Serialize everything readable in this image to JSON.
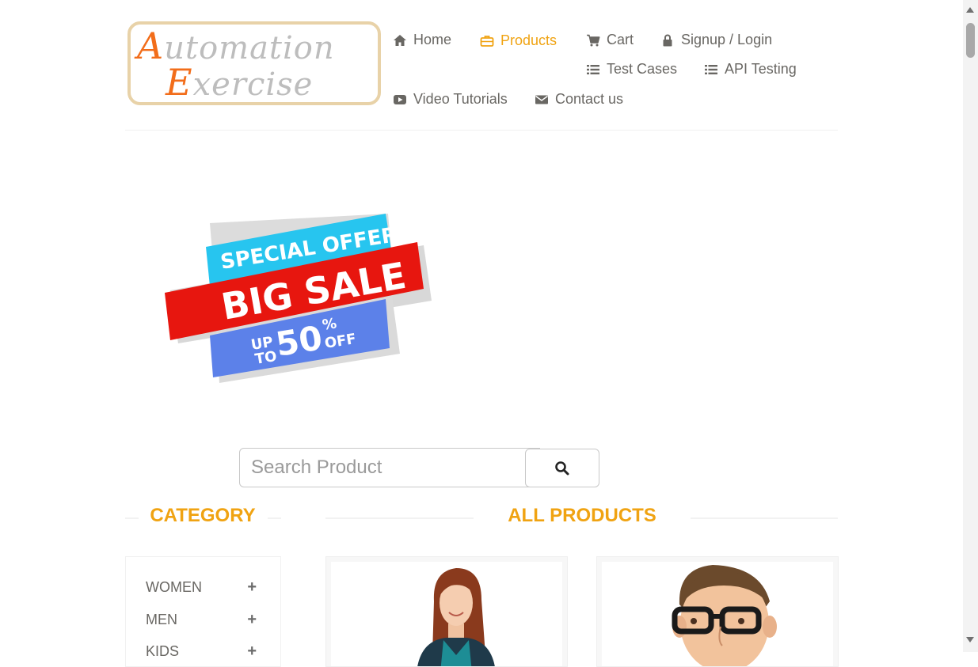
{
  "logo": {
    "line1_cap": "A",
    "line1_rest": "utomation",
    "line2_cap": "E",
    "line2_rest": "xercise"
  },
  "nav": {
    "home": "Home",
    "products": "Products",
    "cart": "Cart",
    "signup_login": "Signup / Login",
    "test_cases": "Test Cases",
    "api_testing": "API Testing",
    "video_tutorials": "Video Tutorials",
    "contact_us": "Contact us"
  },
  "banner": {
    "line1": "SPECIAL OFFER",
    "line2": "BIG SALE",
    "up": "UP",
    "to": "TO",
    "num": "50",
    "pct": "%",
    "off": "OFF"
  },
  "search": {
    "placeholder": "Search Product"
  },
  "category": {
    "title": "CATEGORY",
    "items": [
      {
        "label": "WOMEN"
      },
      {
        "label": "MEN"
      },
      {
        "label": "KIDS"
      }
    ]
  },
  "products": {
    "title": "ALL PRODUCTS"
  },
  "colors": {
    "accent": "#f0a312",
    "text": "#696763"
  }
}
